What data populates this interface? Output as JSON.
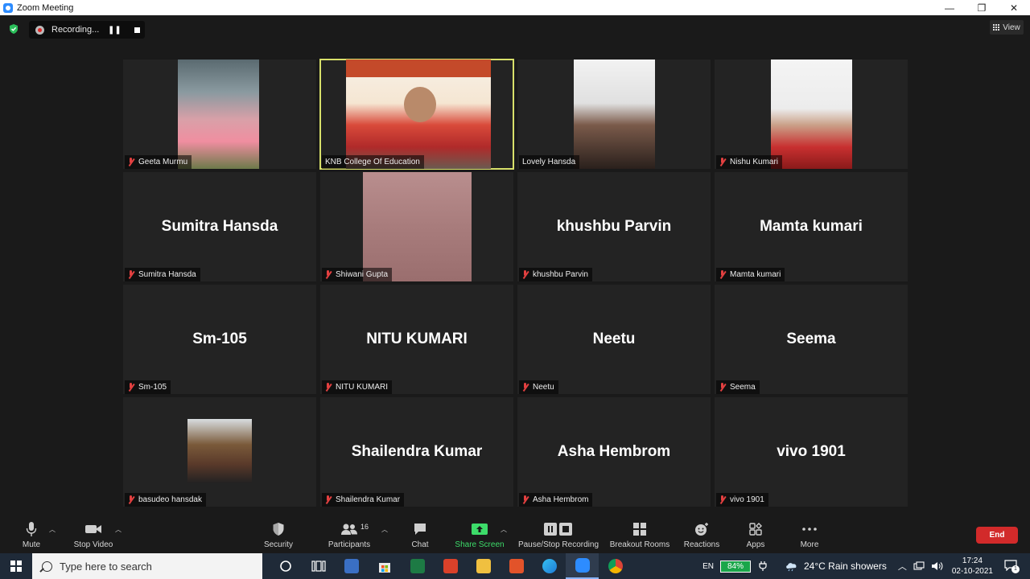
{
  "window": {
    "title": "Zoom Meeting",
    "minimize": "—",
    "maximize": "❐",
    "close": "✕"
  },
  "recording": {
    "status": "Recording...",
    "pause_glyph": "❚❚"
  },
  "view_button": {
    "label": "View"
  },
  "tiles": [
    {
      "name": "Geeta Murmu",
      "big": "",
      "video": true,
      "muted": true
    },
    {
      "name": "KNB College Of Education",
      "big": "",
      "video": true,
      "muted": false,
      "active": true
    },
    {
      "name": "Lovely Hansda",
      "big": "",
      "video": true,
      "muted": false
    },
    {
      "name": "Nishu Kumari",
      "big": "",
      "video": true,
      "muted": true
    },
    {
      "name": "Sumitra Hansda",
      "big": "Sumitra Hansda",
      "video": false,
      "muted": true
    },
    {
      "name": "Shiwani Gupta",
      "big": "",
      "video": true,
      "muted": true
    },
    {
      "name": "khushbu Parvin",
      "big": "khushbu Parvin",
      "video": false,
      "muted": true
    },
    {
      "name": "Mamta kumari",
      "big": "Mamta kumari",
      "video": false,
      "muted": true
    },
    {
      "name": "Sm-105",
      "big": "Sm-105",
      "video": false,
      "muted": true
    },
    {
      "name": "NITU KUMARI",
      "big": "NITU KUMARI",
      "video": false,
      "muted": true
    },
    {
      "name": "Neetu",
      "big": "Neetu",
      "video": false,
      "muted": true
    },
    {
      "name": "Seema",
      "big": "Seema",
      "video": false,
      "muted": true
    },
    {
      "name": "basudeo hansdak",
      "big": "",
      "video": true,
      "muted": true
    },
    {
      "name": "Shailendra Kumar",
      "big": "Shailendra Kumar",
      "video": false,
      "muted": true
    },
    {
      "name": "Asha Hembrom",
      "big": "Asha Hembrom",
      "video": false,
      "muted": true
    },
    {
      "name": "vivo 1901",
      "big": "vivo 1901",
      "video": false,
      "muted": true
    }
  ],
  "toolbar": {
    "mute": "Mute",
    "stop_video": "Stop Video",
    "security": "Security",
    "participants": "Participants",
    "participants_count": "16",
    "chat": "Chat",
    "share_screen": "Share Screen",
    "pause_stop_recording": "Pause/Stop Recording",
    "breakout_rooms": "Breakout Rooms",
    "reactions": "Reactions",
    "apps": "Apps",
    "more": "More",
    "end": "End"
  },
  "taskbar": {
    "search_placeholder": "Type here to search",
    "language": "EN",
    "battery": "84%",
    "weather": "24°C  Rain showers",
    "time": "17:24",
    "date": "02-10-2021",
    "notification_count": "1"
  },
  "colors": {
    "active_speaker": "#d8e06a",
    "share_green": "#3ddc6a",
    "end_red": "#d22a2a",
    "muted_red": "#e34040"
  }
}
